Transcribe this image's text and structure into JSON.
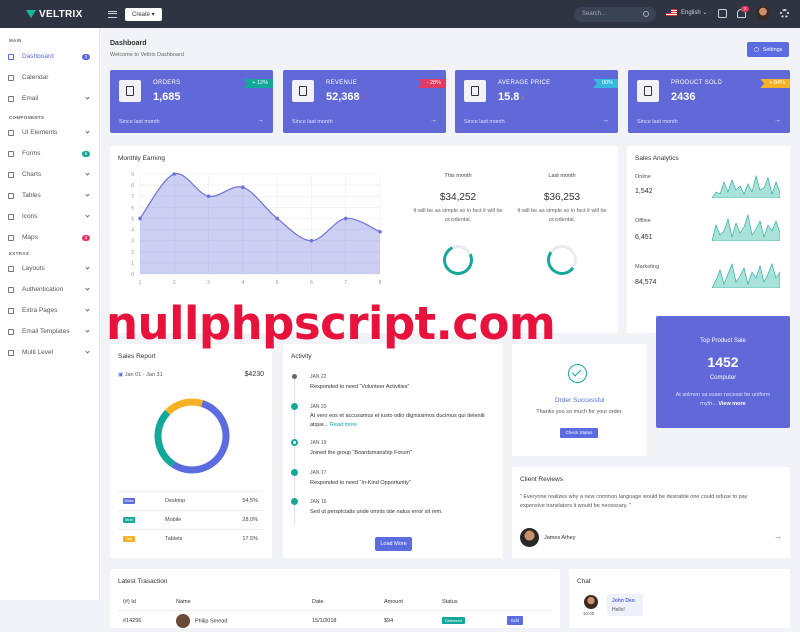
{
  "brand": "VELTRIX",
  "topbar": {
    "create": "Create",
    "search_placeholder": "Search...",
    "language": "English",
    "notif_count": "3"
  },
  "sidebar": {
    "sections": [
      "MAIN",
      "COMPONENTS",
      "EXTRAS"
    ],
    "items": [
      {
        "label": "Dashboard",
        "badge": "2",
        "badge_color": "#5b6be0"
      },
      {
        "label": "Calendar"
      },
      {
        "label": "Email"
      },
      {
        "label": "UI Elements"
      },
      {
        "label": "Forms",
        "badge": "6",
        "badge_color": "#14a89a"
      },
      {
        "label": "Charts"
      },
      {
        "label": "Tables"
      },
      {
        "label": "Icons"
      },
      {
        "label": "Maps",
        "badge": "2",
        "badge_color": "#e23a63"
      },
      {
        "label": "Layouts"
      },
      {
        "label": "Authentication"
      },
      {
        "label": "Extra Pages"
      },
      {
        "label": "Email Templates"
      },
      {
        "label": "Multi Level"
      }
    ]
  },
  "page": {
    "title": "Dashboard",
    "subtitle": "Welcome to Veltrix Dashboard",
    "settings": "Settings"
  },
  "stats": [
    {
      "title": "ORDERS",
      "value": "1,685",
      "badge": "+ 12%",
      "badge_color": "#14a89a",
      "arrow": "↑",
      "arrow_color": "#14b8a0",
      "footer": "Since last month"
    },
    {
      "title": "REVENUE",
      "value": "52,368",
      "badge": "- 28%",
      "badge_color": "#e23a63",
      "arrow": "↓",
      "arrow_color": "#e23a63",
      "footer": "Since last month"
    },
    {
      "title": "AVERAGE PRICE",
      "value": "15.8",
      "badge": "00%",
      "badge_color": "#35b8e0",
      "arrow": "↓",
      "arrow_color": "#e2a03a",
      "footer": "Since last month"
    },
    {
      "title": "PRODUCT SOLD",
      "value": "2436",
      "badge": "+ 84%",
      "badge_color": "#f5b225",
      "arrow": "↑",
      "arrow_color": "#14b8a0",
      "footer": "Since last month"
    }
  ],
  "monthly": {
    "title": "Monthly Earning",
    "this_label": "This month",
    "this_value": "$34,252",
    "last_label": "Last month",
    "last_value": "$36,253",
    "text1": "It will be as simple as in fact it will be occidental.",
    "text2": "It will be as simple as in fact it will be occidental."
  },
  "chart_data": {
    "type": "area",
    "x": [
      1,
      2,
      3,
      4,
      5,
      6,
      7,
      8
    ],
    "values": [
      5,
      9,
      7,
      7.8,
      5,
      3,
      5,
      3.8
    ],
    "xlim": [
      1,
      8
    ],
    "ylim": [
      0,
      9
    ],
    "yticks": [
      0,
      1,
      2,
      3,
      4,
      5,
      6,
      7,
      8,
      9
    ],
    "xticks": [
      1,
      2,
      3,
      4,
      5,
      6,
      7,
      8
    ],
    "grid": true,
    "color": "#6d73d9"
  },
  "sales_analytics": {
    "title": "Sales Analytics",
    "rows": [
      {
        "label": "Online",
        "value": "1,542"
      },
      {
        "label": "Offline",
        "value": "6,451"
      },
      {
        "label": "Marketing",
        "value": "84,574"
      }
    ]
  },
  "sales_report": {
    "title": "Sales Report",
    "date": "Jan 01 - Jan 31",
    "total": "$4230",
    "rows": [
      {
        "badge": "Desk",
        "label": "Desktop",
        "value": "54.5%",
        "color": "#5b6be0"
      },
      {
        "badge": "Mob",
        "label": "Mobile",
        "value": "28.0%",
        "color": "#14a89a"
      },
      {
        "badge": "Tab",
        "label": "Tablets",
        "value": "17.5%",
        "color": "#f5b225"
      }
    ]
  },
  "activity": {
    "title": "Activity",
    "items": [
      {
        "date": "JAN 22",
        "text": "Responded to need “Volunteer Activities”"
      },
      {
        "date": "JAN 20",
        "text": "At vero eos et accusamus et iusto odio dignissimos ducimus qui deleniti atque...",
        "link": "Read more"
      },
      {
        "date": "JAN 19",
        "text": "Joined the group “Boardsmanship Forum”"
      },
      {
        "date": "JAN 17",
        "text": "Responded to need “In-Kind Opportunity”"
      },
      {
        "date": "JAN 16",
        "text": "Sed ut perspiciatis unde omnis iste natus error sit rem."
      }
    ],
    "button": "Load More"
  },
  "order": {
    "title": "Order Successful",
    "text": "Thanks you so much for your order.",
    "button": "Check Status"
  },
  "top_product": {
    "title": "Top Product Sale",
    "value": "1452",
    "name": "Computer",
    "text": "At solmen va esser necessi far uniform myth...",
    "link": "View more"
  },
  "reviews": {
    "title": "Client Reviews",
    "quote": "” Everyone realizes why a new common language would be desirable one could refuse to pay expensive translators it would be necessary. ”",
    "author": "James Athey"
  },
  "transactions": {
    "title": "Latest Trasaction",
    "headers": [
      "(#) Id",
      "Name",
      "Date",
      "Amount",
      "Status"
    ],
    "row": [
      "#14256",
      "Philip Smead",
      "15/1/2018",
      "$94",
      "Delivered"
    ],
    "edit": "Edit"
  },
  "chat": {
    "title": "Chat",
    "name": "John Deo",
    "msg": "Hello!",
    "time": "10:00"
  },
  "watermark": "nullphpscript.com"
}
